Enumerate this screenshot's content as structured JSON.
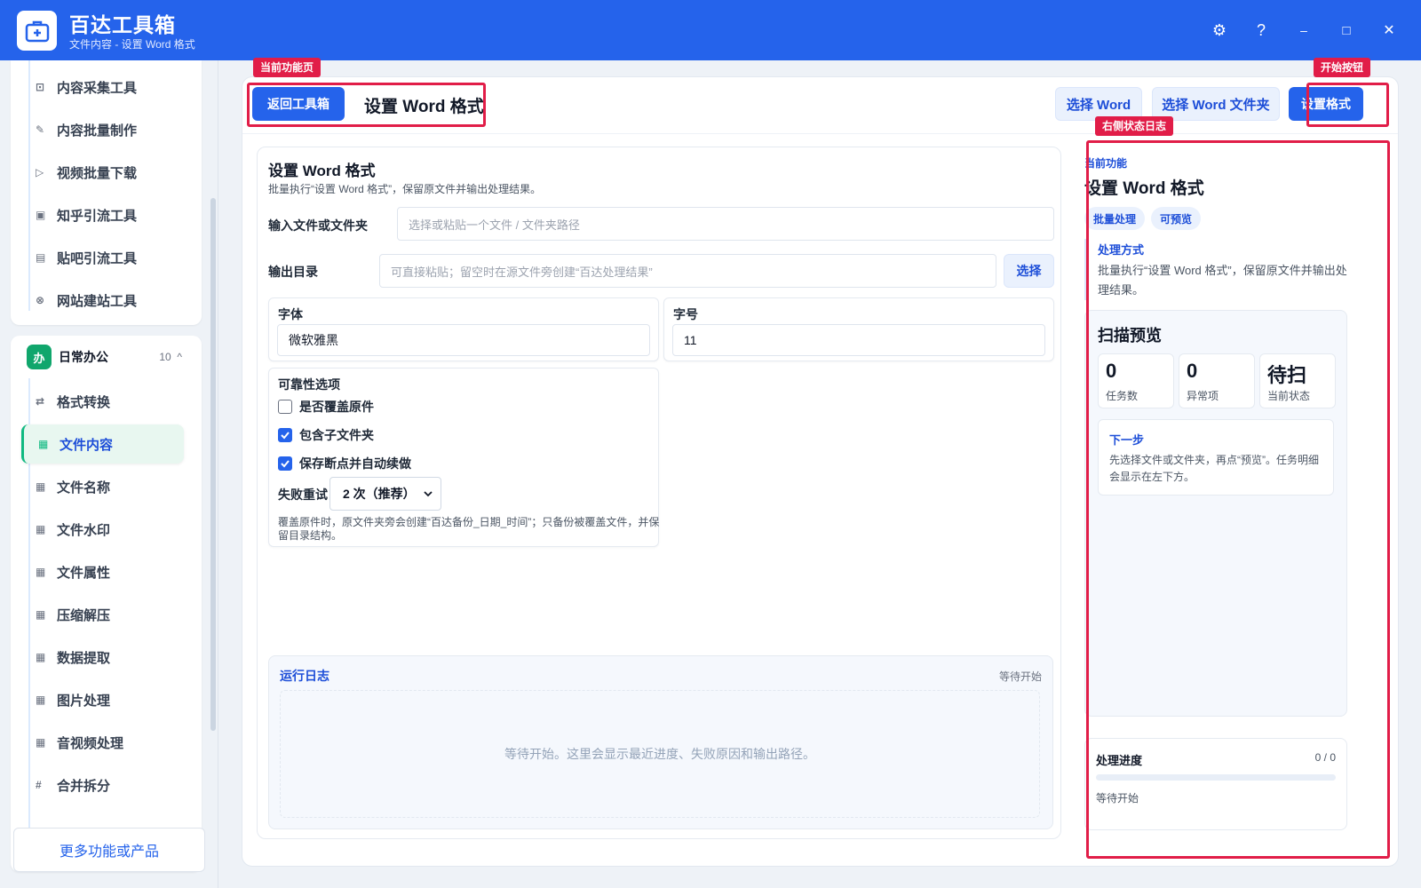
{
  "app": {
    "title": "百达工具箱",
    "subtitle": "文件内容 - 设置 Word 格式"
  },
  "window_controls": {
    "settings": "⚙",
    "help": "?",
    "minimize": "–",
    "maximize": "□",
    "close": "✕"
  },
  "sidebar": {
    "group_top_items": [
      {
        "label": "内容采集工具",
        "icon": "collect-icon"
      },
      {
        "label": "内容批量制作",
        "icon": "pen-icon"
      },
      {
        "label": "视频批量下载",
        "icon": "video-icon"
      },
      {
        "label": "知乎引流工具",
        "icon": "zhihu-icon"
      },
      {
        "label": "贴吧引流工具",
        "icon": "tieba-icon"
      },
      {
        "label": "网站建站工具",
        "icon": "web-icon"
      }
    ],
    "group": {
      "badge": "办",
      "label": "日常办公",
      "count": "10",
      "caret": "^"
    },
    "group_items": [
      {
        "label": "格式转换",
        "icon": "⇄",
        "active": false
      },
      {
        "label": "文件内容",
        "icon": "▦",
        "active": true
      },
      {
        "label": "文件名称",
        "icon": "▦",
        "active": false
      },
      {
        "label": "文件水印",
        "icon": "▦",
        "active": false
      },
      {
        "label": "文件属性",
        "icon": "▦",
        "active": false
      },
      {
        "label": "压缩解压",
        "icon": "▦",
        "active": false
      },
      {
        "label": "数据提取",
        "icon": "▦",
        "active": false
      },
      {
        "label": "图片处理",
        "icon": "▦",
        "active": false
      },
      {
        "label": "音视频处理",
        "icon": "▦",
        "active": false
      },
      {
        "label": "合并拆分",
        "icon": "#",
        "active": false
      }
    ],
    "more_button": "更多功能或产品"
  },
  "toolbar": {
    "back_button": "返回工具箱",
    "page_title": "设置 Word 格式",
    "select_word": "选择 Word",
    "select_folder": "选择 Word 文件夹",
    "start_button": "设置格式"
  },
  "annotations": {
    "current_page": "当前功能页",
    "start_button": "开始按钮",
    "right_log": "右侧状态日志"
  },
  "form": {
    "title": "设置 Word 格式",
    "description": "批量执行“设置 Word 格式”，保留原文件并输出处理结果。",
    "input_label": "输入文件或文件夹",
    "input_placeholder": "选择或粘贴一个文件 / 文件夹路径",
    "output_label": "输出目录",
    "output_placeholder": "可直接粘贴；留空时在源文件旁创建“百达处理结果”",
    "output_button": "选择",
    "font_label": "字体",
    "font_value": "微软雅黑",
    "size_label": "字号",
    "size_value": "11",
    "reliability": {
      "label": "可靠性选项",
      "options": [
        {
          "label": "是否覆盖原件",
          "checked": false
        },
        {
          "label": "包含子文件夹",
          "checked": true
        },
        {
          "label": "保存断点并自动续做",
          "checked": true
        }
      ],
      "retry_label": "失败重试",
      "retry_value": "2 次（推荐）",
      "note": "覆盖原件时，原文件夹旁会创建“百达备份_日期_时间”；只备份被覆盖文件，并保留目录结构。"
    }
  },
  "log": {
    "title": "运行日志",
    "status": "等待开始",
    "placeholder": "等待开始。这里会显示最近进度、失败原因和输出路径。"
  },
  "right_panel": {
    "kicker": "当前功能",
    "title": "设置 Word 格式",
    "chips": [
      "批量处理",
      "可预览"
    ],
    "method_title": "处理方式",
    "method_desc": "批量执行“设置 Word 格式”，保留原文件并输出处理结果。",
    "scan": {
      "title": "扫描预览",
      "stats": [
        {
          "value": "0",
          "label": "任务数"
        },
        {
          "value": "0",
          "label": "异常项"
        },
        {
          "value": "待扫",
          "label": "当前状态"
        }
      ],
      "next_title": "下一步",
      "next_desc": "先选择文件或文件夹，再点“预览”。任务明细会显示在左下方。"
    },
    "progress": {
      "title": "处理进度",
      "count": "0 / 0",
      "fraction": 0,
      "status": "等待开始"
    }
  },
  "colors": {
    "brand": "#2563eb",
    "annotation": "#e11d48",
    "group_badge": "#10a66c"
  }
}
